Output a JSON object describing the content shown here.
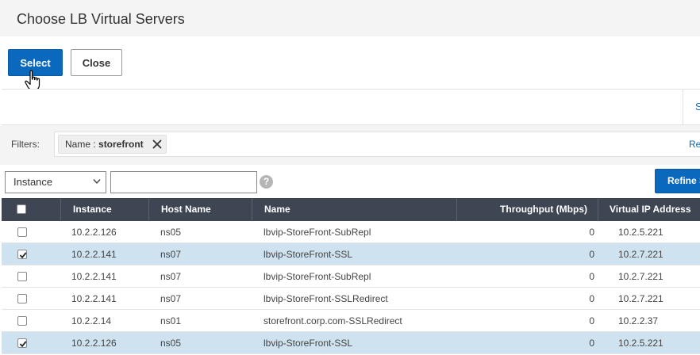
{
  "dialog": {
    "title": "Choose LB Virtual Servers"
  },
  "toolbar": {
    "select_label": "Select",
    "close_label": "Close"
  },
  "panel": {
    "link_text": "S"
  },
  "filters": {
    "label": "Filters:",
    "chip_key": "Name : ",
    "chip_value": "storefront",
    "right_link": "Re"
  },
  "search": {
    "category_value": "Instance",
    "query_value": "",
    "help_label": "?",
    "refine_label": "Refine S"
  },
  "table": {
    "columns": [
      "Instance",
      "Host Name",
      "Name",
      "Throughput (Mbps)",
      "Virtual IP Address"
    ],
    "rows": [
      {
        "checked": false,
        "instance": "10.2.2.126",
        "host": "ns05",
        "name": "lbvip-StoreFront-SubRepl",
        "throughput": "0",
        "vip": "10.2.5.221"
      },
      {
        "checked": true,
        "instance": "10.2.2.141",
        "host": "ns07",
        "name": "lbvip-StoreFront-SSL",
        "throughput": "0",
        "vip": "10.2.7.221"
      },
      {
        "checked": false,
        "instance": "10.2.2.141",
        "host": "ns07",
        "name": "lbvip-StoreFront-SubRepl",
        "throughput": "0",
        "vip": "10.2.7.221"
      },
      {
        "checked": false,
        "instance": "10.2.2.141",
        "host": "ns07",
        "name": "lbvip-StoreFront-SSLRedirect",
        "throughput": "0",
        "vip": "10.2.7.221"
      },
      {
        "checked": false,
        "instance": "10.2.2.14",
        "host": "ns01",
        "name": "storefront.corp.com-SSLRedirect",
        "throughput": "0",
        "vip": "10.2.2.37"
      },
      {
        "checked": true,
        "instance": "10.2.2.126",
        "host": "ns05",
        "name": "lbvip-StoreFront-SSL",
        "throughput": "0",
        "vip": "10.2.5.221"
      }
    ]
  },
  "icons": {
    "cursor": "hand-pointer-icon",
    "chip_remove": "close-icon",
    "select_caret": "chevron-down-icon",
    "help": "help-icon",
    "checkbox": "checkbox-icon"
  },
  "colors": {
    "accent": "#0b69bd",
    "header": "#3e4553",
    "selected_row": "#cfe2ef"
  }
}
